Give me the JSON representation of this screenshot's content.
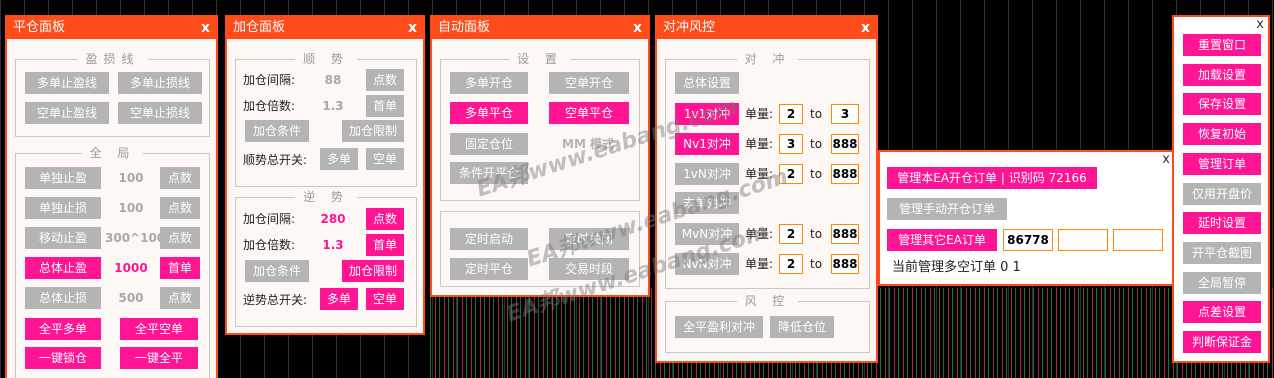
{
  "panel_close": {
    "title": "平仓面板",
    "close": "x",
    "profit_loss_group": "盈损线",
    "buttons_top": [
      "多单止盈线",
      "多单止损线",
      "空单止盈线",
      "空单止损线"
    ],
    "global_group": "全 局",
    "rows": [
      {
        "label": "单独止盈",
        "value": "100",
        "unit": "点数"
      },
      {
        "label": "单独止损",
        "value": "100",
        "unit": "点数"
      },
      {
        "label": "移动止盈",
        "value": "300^100",
        "unit": "点数"
      },
      {
        "label": "总体止盈",
        "value": "1000",
        "unit": "首单"
      },
      {
        "label": "总体止损",
        "value": "500",
        "unit": "点数"
      }
    ],
    "close_long": "全平多单",
    "close_short": "全平空单",
    "lock": "一键锁仓",
    "close_all": "一键全平"
  },
  "panel_add": {
    "title": "加仓面板",
    "close": "x",
    "trend_group": "顺 势",
    "trend": {
      "interval_label": "加仓间隔:",
      "interval_value": "88",
      "interval_unit": "点数",
      "multiplier_label": "加仓倍数:",
      "multiplier_value": "1.3",
      "multiplier_unit": "首单",
      "condition": "加仓条件",
      "limit": "加仓限制",
      "switch_label": "顺势总开关:",
      "long": "多单",
      "short": "空单"
    },
    "counter_group": "逆 势",
    "counter": {
      "interval_label": "加仓间隔:",
      "interval_value": "280",
      "interval_unit": "点数",
      "multiplier_label": "加仓倍数:",
      "multiplier_value": "1.3",
      "multiplier_unit": "首单",
      "condition": "加仓条件",
      "limit": "加仓限制",
      "switch_label": "逆势总开关:",
      "long": "多单",
      "short": "空单"
    }
  },
  "panel_auto": {
    "title": "自动面板",
    "close": "x",
    "settings_group": "设 置",
    "buttons": [
      "多单开仓",
      "空单开仓",
      "多单平仓",
      "空单平仓",
      "固定仓位",
      "条件开平仓"
    ],
    "mode_text": "MM 模式",
    "timer_buttons": [
      "定时启动",
      "定时关闭",
      "定时平仓",
      "交易时段"
    ]
  },
  "panel_hedge": {
    "title": "对冲风控",
    "close": "x",
    "hedge_group": "对 冲",
    "overall": "总体设置",
    "rows": [
      {
        "name": "1v1对冲",
        "qty_label": "单量:",
        "a": "2",
        "to": "to",
        "b": "3"
      },
      {
        "name": "Nv1对冲",
        "qty_label": "单量:",
        "a": "3",
        "to": "to",
        "b": "888"
      },
      {
        "name": "1vN对冲",
        "qty_label": "单量:",
        "a": "2",
        "to": "to",
        "b": "888"
      },
      {
        "name": "末单对冲"
      },
      {
        "name": "MvN对冲",
        "qty_label": "单量:",
        "a": "2",
        "to": "to",
        "b": "888"
      },
      {
        "name": "NvN对冲",
        "qty_label": "单量:",
        "a": "2",
        "to": "to",
        "b": "888"
      }
    ],
    "risk_group": "风 控",
    "risk_buttons": [
      "全平盈利对冲",
      "降低仓位"
    ]
  },
  "panel_manage": {
    "close": "x",
    "manage_ea": "管理本EA开仓订单 | 识别码 72166",
    "manage_manual": "管理手动开仓订单",
    "manage_other": "管理其它EA订单",
    "other_id": "86778",
    "status": "当前管理多空订单 0 1"
  },
  "side_menu": {
    "close": "x",
    "items": [
      {
        "label": "重置窗口",
        "style": "pink"
      },
      {
        "label": "加载设置",
        "style": "pink"
      },
      {
        "label": "保存设置",
        "style": "pink"
      },
      {
        "label": "恢复初始",
        "style": "pink"
      },
      {
        "label": "管理订单",
        "style": "pink"
      },
      {
        "label": "仅用开盘价",
        "style": "gray"
      },
      {
        "label": "延时设置",
        "style": "pink"
      },
      {
        "label": "开平仓截图",
        "style": "gray"
      },
      {
        "label": "全局暂停",
        "style": "gray"
      },
      {
        "label": "点差设置",
        "style": "pink"
      },
      {
        "label": "判断保证金",
        "style": "pink"
      }
    ]
  },
  "watermark": "EA邦www.eabang.com",
  "colors": {
    "accent": "#ff4a1a",
    "pink": "#ff1493",
    "gray": "#b4b4b4",
    "box_border": "#ff8c00"
  }
}
